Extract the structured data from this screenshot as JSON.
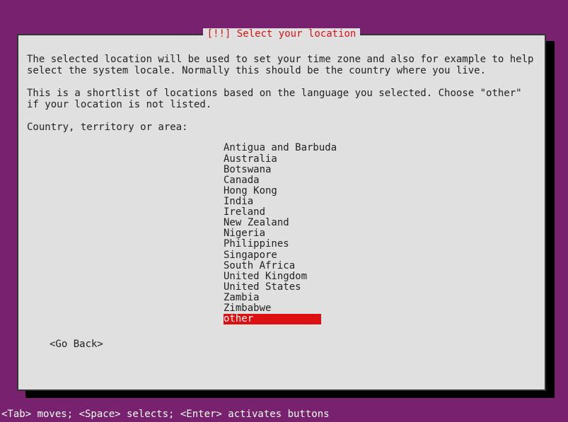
{
  "dialog": {
    "title": "[!!] Select your location",
    "paragraph1": "The selected location will be used to set your time zone and also for example to help select the system locale. Normally this should be the country where you live.",
    "paragraph2": "This is a shortlist of locations based on the language you selected. Choose \"other\" if your location is not listed.",
    "prompt": "Country, territory or area:",
    "items": [
      "Antigua and Barbuda",
      "Australia",
      "Botswana",
      "Canada",
      "Hong Kong",
      "India",
      "Ireland",
      "New Zealand",
      "Nigeria",
      "Philippines",
      "Singapore",
      "South Africa",
      "United Kingdom",
      "United States",
      "Zambia",
      "Zimbabwe",
      "other"
    ],
    "selected_index": 16,
    "go_back": "<Go Back>"
  },
  "help_bar": "<Tab> moves; <Space> selects; <Enter> activates buttons"
}
